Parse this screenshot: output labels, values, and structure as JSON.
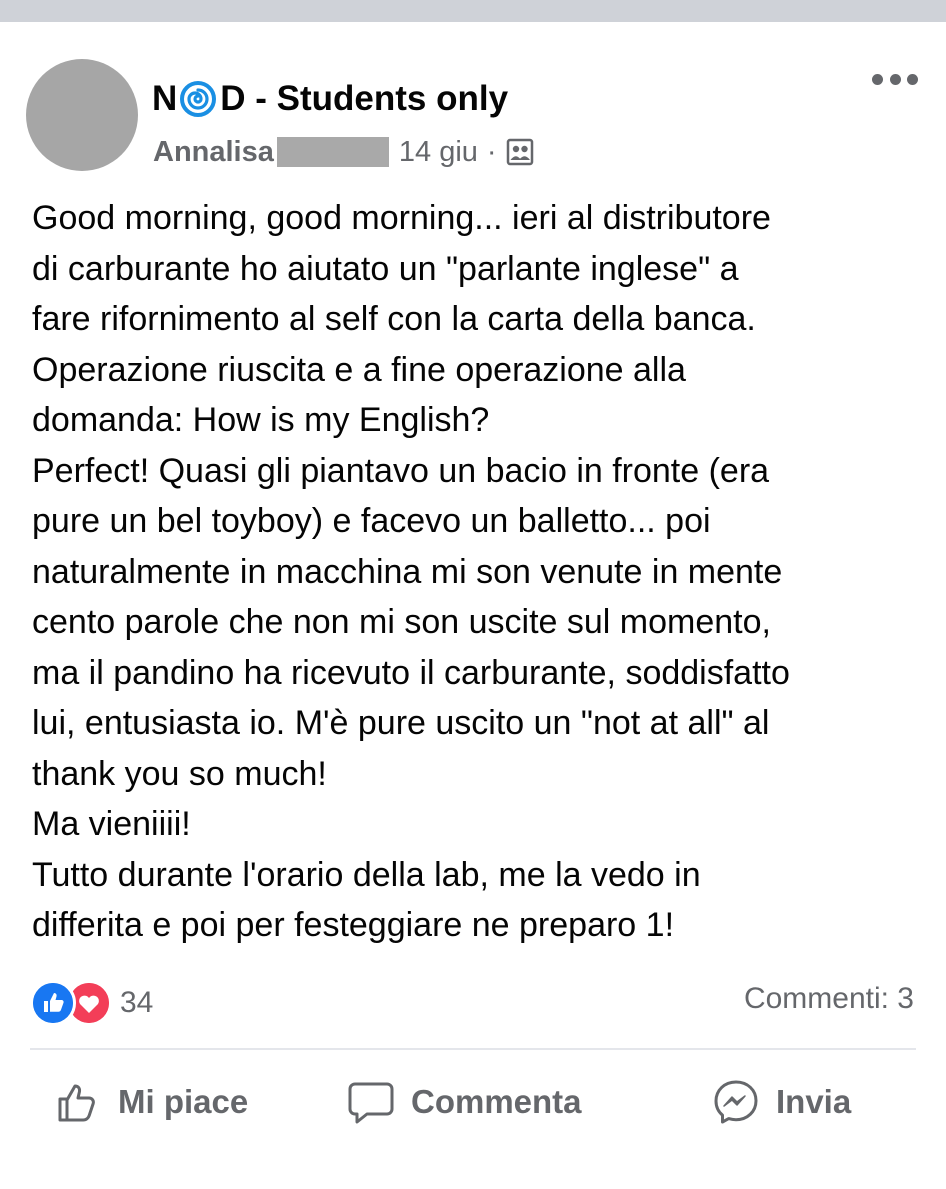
{
  "group": {
    "name_part1": "N",
    "name_part2": "D - Students only"
  },
  "post": {
    "author": "Annalisa",
    "date": "14 giu",
    "separator": "·",
    "lines": [
      "Good morning, good morning... ieri al distributore",
      "di carburante ho aiutato un \"parlante inglese\" a",
      "fare rifornimento al self con la carta della banca.",
      "Operazione riuscita e a fine operazione alla",
      "domanda: How is my English?",
      "Perfect! Quasi gli piantavo un bacio in fronte (era",
      "pure un bel toyboy) e facevo un balletto... poi",
      "naturalmente in macchina mi son venute in mente",
      "cento parole che non mi son uscite sul momento,",
      "ma il pandino ha ricevuto il carburante, soddisfatto",
      "lui, entusiasta io. M'è pure uscito un \"not at all\" al",
      "thank you so much!",
      "Ma vieniiii!",
      "Tutto durante l'orario della lab, me la vedo in",
      "differita e poi per festeggiare ne preparo 1!"
    ]
  },
  "stats": {
    "reactions_count": "34",
    "comments_label": "Commenti: 3"
  },
  "actions": {
    "like": "Mi piace",
    "comment": "Commenta",
    "share": "Invia"
  },
  "icons": {
    "more": "more-options-icon",
    "privacy": "group-members-icon",
    "like": "thumbs-up-icon",
    "comment": "speech-bubble-icon",
    "share": "messenger-icon"
  },
  "colors": {
    "like_blue": "#1877f2",
    "love_red": "#f33e58",
    "secondary_text": "#65676b",
    "logo_blue": "#1a8fe3"
  }
}
